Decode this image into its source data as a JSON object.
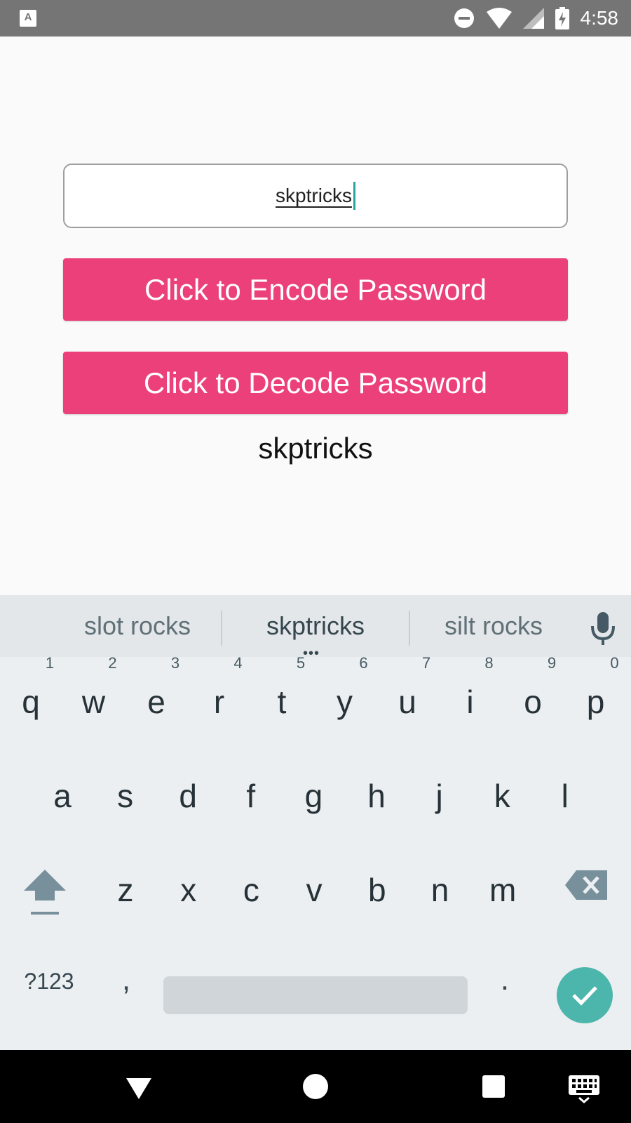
{
  "status_bar": {
    "app_icon_letter": "A",
    "time": "4:58",
    "background": "#757575"
  },
  "form": {
    "input_value": "skptricks",
    "encode_label": "Click to Encode Password",
    "decode_label": "Click to Decode Password",
    "result": "skptricks",
    "button_color": "#ec407a",
    "caret_color": "#26a69a"
  },
  "keyboard": {
    "suggestions": [
      "slot rocks",
      "skptricks",
      "silt rocks"
    ],
    "row1": [
      {
        "key": "q",
        "hint": "1"
      },
      {
        "key": "w",
        "hint": "2"
      },
      {
        "key": "e",
        "hint": "3"
      },
      {
        "key": "r",
        "hint": "4"
      },
      {
        "key": "t",
        "hint": "5"
      },
      {
        "key": "y",
        "hint": "6"
      },
      {
        "key": "u",
        "hint": "7"
      },
      {
        "key": "i",
        "hint": "8"
      },
      {
        "key": "o",
        "hint": "9"
      },
      {
        "key": "p",
        "hint": "0"
      }
    ],
    "row2": [
      "a",
      "s",
      "d",
      "f",
      "g",
      "h",
      "j",
      "k",
      "l"
    ],
    "row3": [
      "z",
      "x",
      "c",
      "v",
      "b",
      "n",
      "m"
    ],
    "symbols_label": "?123",
    "comma": ",",
    "period": ".",
    "done_color": "#4db6ac",
    "icons": {
      "mic": "microphone-icon",
      "shift": "shift-icon",
      "backspace": "backspace-icon",
      "done": "check-icon"
    }
  },
  "nav_bar": {
    "icons": [
      "back-icon",
      "home-icon",
      "recents-icon",
      "keyboard-switch-icon"
    ]
  }
}
